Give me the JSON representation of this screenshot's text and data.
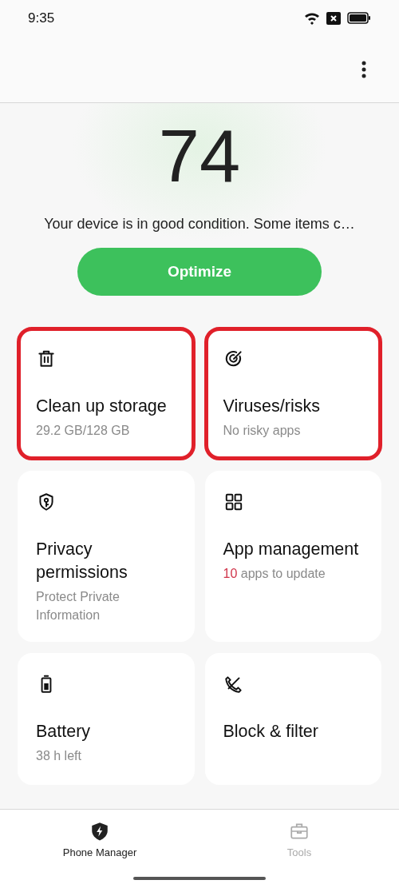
{
  "status_bar": {
    "time": "9:35"
  },
  "score": {
    "value": "74",
    "message": "Your device is in good condition. Some items c…"
  },
  "optimize_button": {
    "label": "Optimize"
  },
  "cards": [
    {
      "kind": "trash",
      "title": "Clean up storage",
      "subtitle": "29.2 GB/128 GB",
      "highlighted": true
    },
    {
      "kind": "target",
      "title": "Viruses/risks",
      "subtitle": "No risky apps",
      "highlighted": true
    },
    {
      "kind": "shield-key",
      "title": "Privacy permissions",
      "subtitle": "Protect Private Information",
      "highlighted": false
    },
    {
      "kind": "grid",
      "title": "App management",
      "count": "10",
      "subtitle": "apps to update",
      "highlighted": false
    },
    {
      "kind": "battery",
      "title": "Battery",
      "subtitle": "38 h left",
      "highlighted": false
    },
    {
      "kind": "block",
      "title": "Block & filter",
      "highlighted": false
    }
  ],
  "bottom_nav": [
    {
      "kind": "shield",
      "label": "Phone Manager",
      "selected": true
    },
    {
      "kind": "toolbox",
      "label": "Tools",
      "selected": false
    }
  ]
}
